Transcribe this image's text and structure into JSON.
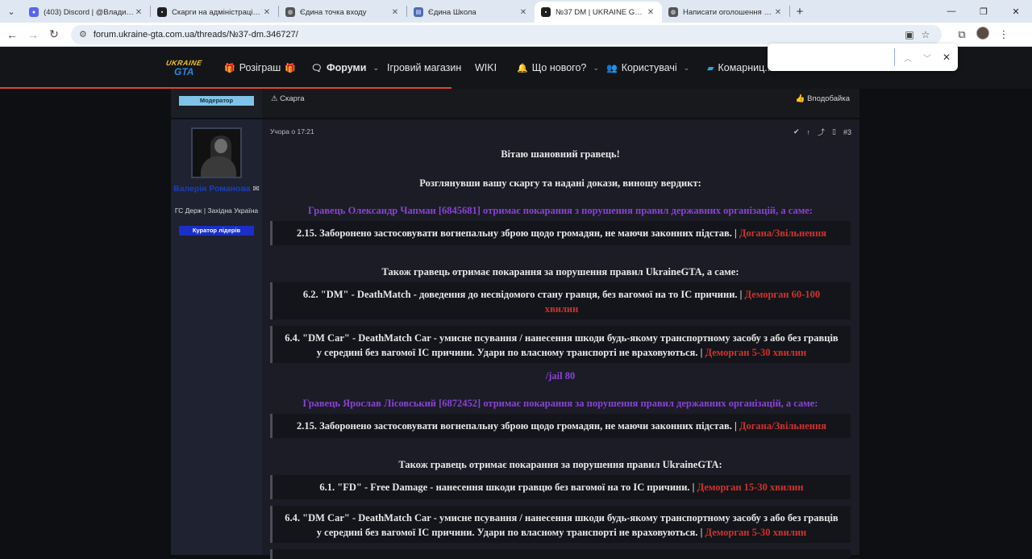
{
  "browser": {
    "tabs": [
      {
        "title": "(403) Discord | @Владислав Д...",
        "fav_color": "#5865f2",
        "fav_text": "403",
        "active": false
      },
      {
        "title": "Скарги на адміністрацію | UKR...",
        "fav_color": "#1f1f1f",
        "fav_text": "",
        "active": false
      },
      {
        "title": "Єдина точка входу",
        "fav_color": "#555555",
        "fav_text": "",
        "active": false
      },
      {
        "title": "Єдина Школа",
        "fav_color": "#4b6cb7",
        "fav_text": "",
        "active": false
      },
      {
        "title": "№37 DM | UKRAINE GTA - Ігро...",
        "fav_color": "#1f1f1f",
        "fav_text": "",
        "active": true
      },
      {
        "title": "Написати оголошення польс...",
        "fav_color": "#555555",
        "fav_text": "",
        "active": false
      }
    ],
    "url": "forum.ukraine-gta.com.ua/threads/№37-dm.346727/"
  },
  "site_nav": {
    "logo_top": "UKRAINE",
    "logo_bottom": "GTA",
    "items": [
      {
        "label": "Розіграш",
        "icon": "🎁"
      },
      {
        "label": "Форуми",
        "icon": "🗨"
      },
      {
        "label": "Ігровий магазин",
        "icon": ""
      },
      {
        "label": "WIKI",
        "icon": ""
      },
      {
        "label": "Що нового?",
        "icon": "🔔"
      },
      {
        "label": "Користувачі",
        "icon": "👥"
      },
      {
        "label": "Комарниц...",
        "icon": ""
      }
    ]
  },
  "prev_post": {
    "role_badge": "Модератор",
    "report": "Скарга",
    "like": "Вподобайка"
  },
  "post": {
    "username": "Валерія Романова",
    "user_title": "ГС Держ | Західна Україна",
    "user_badge": "Куратор лідерів",
    "time": "Учора о 17:21",
    "number": "#3",
    "greeting": "Вітаю шановний гравець!",
    "verdict": "Розглянувши вашу скаргу та надані докази, виношу вердикт:",
    "p1_heading": "Гравець Олександр Чапман [6845681] отримає покарання з порушення правил державних організацій, а саме:",
    "p1_rule": "2.15. Заборонено застосовувати вогнепальну зброю щодо громадян, не маючи законних підстав. |",
    "p1_rule_pen": "Догана/Звільнення",
    "p1_also": "Також гравець отримає покарання за порушення правил UkraineGTA, а саме:",
    "p1_dm": "6.2. \"DM\" - DeathMatch - доведення до несвідомого стану гравця, без вагомої на то IC причини. |",
    "p1_dm_pen": "Деморган 60-100 хвилин",
    "p1_dmcar": "6.4. \"DM Car\" - DeathMatch Car - умисне псування / нанесення шкоди будь-якому транспортному засобу з або без гравців у середині без вагомої IC причини. Удари по власному транспорті не враховуються. |",
    "p1_dmcar_pen": "Деморган 5-30 хвилин",
    "jail": "/jail 80",
    "p2_heading": "Гравець Ярослав Лісовський [6872452] отримає покарання за порушення правил державних організацій, а саме:",
    "p2_rule": "2.15. Заборонено застосовувати вогнепальну зброю щодо громадян, не маючи законних підстав. |",
    "p2_rule_pen": "Догана/Звільнення",
    "p2_also": "Також гравець отримає покарання за порушення правил UkraineGTA:",
    "p2_fd": "6.1. \"FD\" - Free Damage - нанесення шкоди гравцю без вагомої на то IC причини. |",
    "p2_fd_pen": "Деморган 15-30 хвилин",
    "p2_dmcar": "6.4. \"DM Car\" - DeathMatch Car - умисне псування / нанесення шкоди будь-якому транспортному засобу з або без гравців у середині без вагомої IC причини. Удари по власному транспорті не враховуються. |",
    "p2_dmcar_pen": "Деморган 5-30 хвилин"
  },
  "colors": {
    "accent_violet": "#8a42d6",
    "penalty_red": "#d0322e",
    "username_blue": "#1b3fb8",
    "progress_orange": "#e0452a"
  }
}
